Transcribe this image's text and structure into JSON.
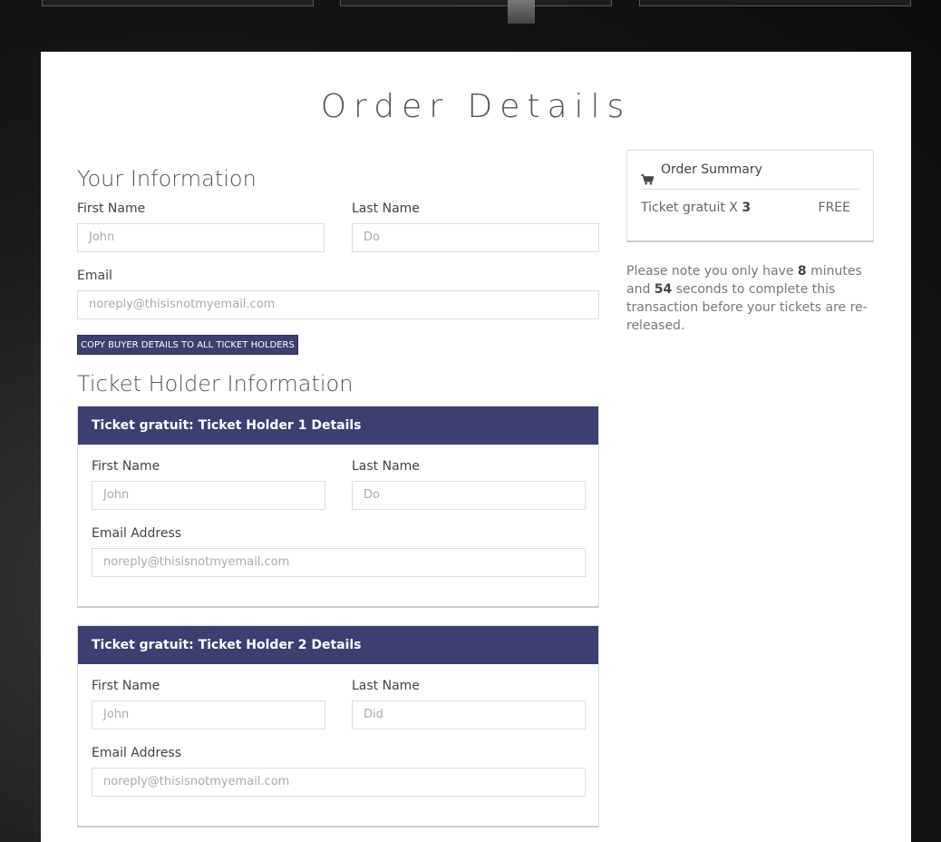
{
  "page_title": "Order Details",
  "your_info": {
    "heading": "Your Information",
    "first_name_label": "First Name",
    "first_name_value": "John",
    "last_name_label": "Last Name",
    "last_name_value": "Do",
    "email_label": "Email",
    "email_value": "noreply@thisisnotmyemail.com",
    "copy_button": "COPY BUYER DETAILS TO ALL TICKET HOLDERS"
  },
  "ticket_holders": {
    "heading": "Ticket Holder Information",
    "holders": [
      {
        "title": "Ticket gratuit: Ticket Holder 1 Details",
        "first_name_label": "First Name",
        "first_name_value": "John",
        "last_name_label": "Last Name",
        "last_name_value": "Do",
        "email_label": "Email Address",
        "email_value": "noreply@thisisnotmyemail.com"
      },
      {
        "title": "Ticket gratuit: Ticket Holder 2 Details",
        "first_name_label": "First Name",
        "first_name_value": "John",
        "last_name_label": "Last Name",
        "last_name_value": "Did",
        "email_label": "Email Address",
        "email_value": "noreply@thisisnotmyemail.com"
      }
    ]
  },
  "order_summary": {
    "heading": "Order Summary",
    "icon": "cart-icon",
    "item_label": "Ticket gratuit X",
    "item_qty": "3",
    "item_price": "FREE"
  },
  "timer_note": {
    "prefix": "Please note you only have",
    "minutes": "8",
    "middle": "minutes and",
    "seconds": "54",
    "suffix": "seconds to complete this transaction before your tickets are re-released."
  },
  "colors": {
    "accent": "#3b4070",
    "panel_bg": "#ffffff",
    "page_bg": "#1a1a1a"
  }
}
